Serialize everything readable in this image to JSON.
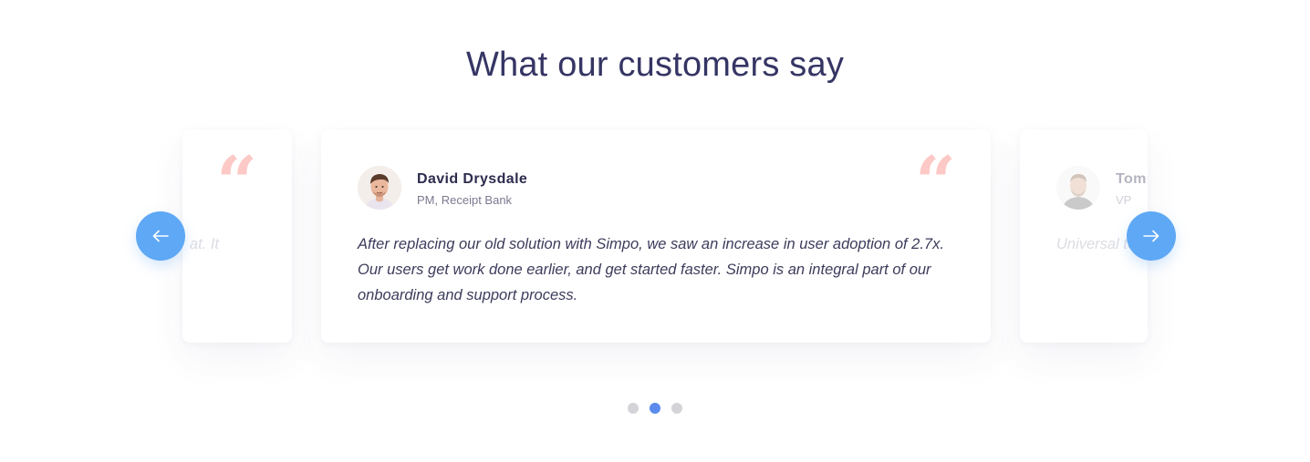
{
  "section": {
    "title": "What our customers say"
  },
  "testimonials": [
    {
      "position": "previous",
      "quote_mark": "“",
      "text": "at. It"
    },
    {
      "position": "current",
      "name": "David Drysdale",
      "role": "PM, Receipt Bank",
      "quote_mark": "“",
      "text": "After replacing our old solution with Simpo, we saw an increase in user adoption of 2.7x. Our users get work done earlier, and get started faster. Simpo is an integral part of our onboarding and support process."
    },
    {
      "position": "next",
      "name": "Tom",
      "role": "VP",
      "text": "Universal to make our ever leaving"
    }
  ],
  "navigation": {
    "prev_icon": "arrow-left-icon",
    "next_icon": "arrow-right-icon",
    "button_color": "#5ea8f5"
  },
  "pagination": {
    "count": 3,
    "active_index": 1,
    "active_color": "#5b8bec",
    "inactive_color": "#d4d4d8"
  },
  "colors": {
    "title": "#353564",
    "quote_mark": "#fcc9c6"
  }
}
